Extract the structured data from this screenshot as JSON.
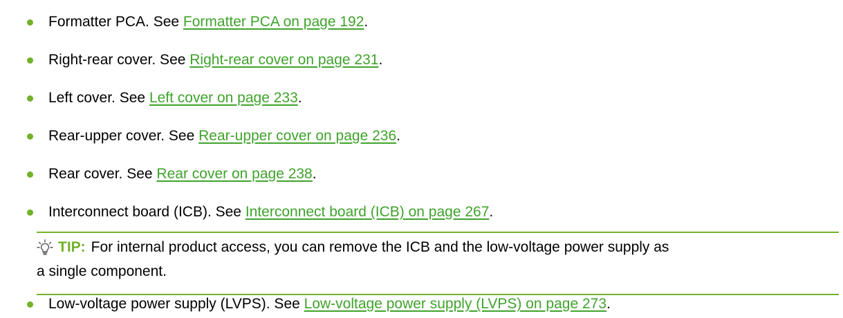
{
  "items_top": [
    {
      "prefix": "Formatter PCA. See ",
      "link": "Formatter PCA on page 192",
      "suffix": "."
    },
    {
      "prefix": "Right-rear cover. See ",
      "link": "Right-rear cover on page 231",
      "suffix": "."
    },
    {
      "prefix": "Left cover. See ",
      "link": "Left cover on page 233",
      "suffix": "."
    },
    {
      "prefix": "Rear-upper cover. See ",
      "link": "Rear-upper cover on page 236",
      "suffix": "."
    },
    {
      "prefix": "Rear cover. See ",
      "link": "Rear cover on page 238",
      "suffix": "."
    },
    {
      "prefix": "Interconnect board (ICB). See ",
      "link": "Interconnect board (ICB) on page 267",
      "suffix": "."
    }
  ],
  "tip": {
    "label": "TIP:",
    "line1": "For internal product access, you can remove the ICB and the low-voltage power supply as",
    "line2": "a single component."
  },
  "items_bottom": [
    {
      "prefix": "Low-voltage power supply (LVPS). See ",
      "link": "Low-voltage power supply (LVPS) on page 273",
      "suffix": "."
    }
  ],
  "colors": {
    "link": "#3fa32b",
    "bullet": "#73b12b",
    "tip_accent": "#73b12b"
  }
}
